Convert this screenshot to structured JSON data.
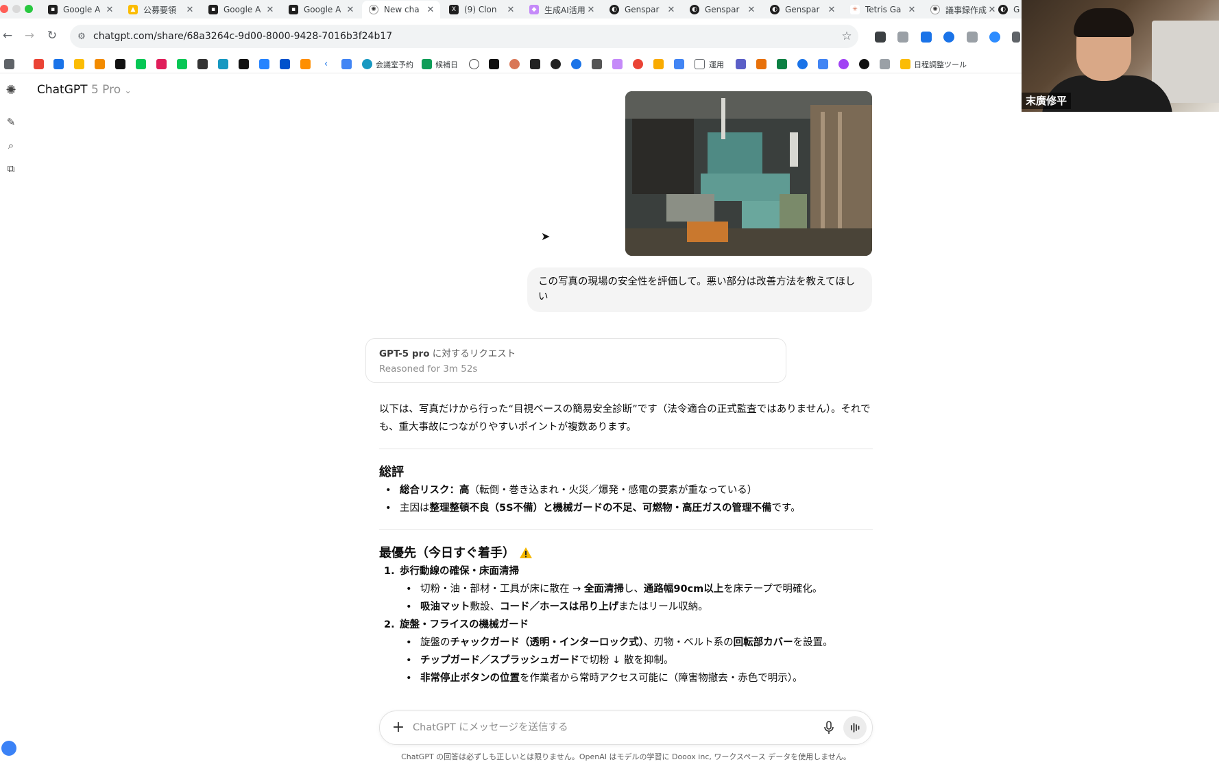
{
  "browser": {
    "tabs": [
      {
        "title": "Google A",
        "icon": "doc-icon"
      },
      {
        "title": "公募要領",
        "icon": "drive-icon"
      },
      {
        "title": "Google A",
        "icon": "doc-icon"
      },
      {
        "title": "Google A",
        "icon": "doc-icon"
      },
      {
        "title": "New cha",
        "icon": "openai-icon",
        "active": true
      },
      {
        "title": "(9) Clon",
        "icon": "x-icon"
      },
      {
        "title": "生成AI活用",
        "icon": "app-icon"
      },
      {
        "title": "Genspar",
        "icon": "genspark-icon"
      },
      {
        "title": "Genspar",
        "icon": "genspark-icon"
      },
      {
        "title": "Genspar",
        "icon": "genspark-icon"
      },
      {
        "title": "Tetris Ga",
        "icon": "claude-icon"
      },
      {
        "title": "議事録作成",
        "icon": "openai-icon"
      },
      {
        "title": "G",
        "icon": "genspark-icon"
      }
    ],
    "url": "chatgpt.com/share/68a3264c-9d00-8000-9428-7016b3f24b17",
    "bookmarks": {
      "meeting_room": "会議室予約",
      "candidate_day": "候補日",
      "operations": "運用",
      "scheduling_tool": "日程調整ツール"
    }
  },
  "webcam": {
    "participant_name": "末廣修平"
  },
  "chat": {
    "app_name": "ChatGPT",
    "model_variant": "5 Pro",
    "user_message": "この写真の現場の安全性を評価して。悪い部分は改善方法を教えてほしい",
    "reasoning": {
      "model": "GPT-5 pro",
      "request_suffix": " に対するリクエスト",
      "duration": "Reasoned for 3m 52s"
    },
    "answer": {
      "intro": "以下は、写真だけから行った“目視ベースの簡易安全診断”です（法令適合の正式監査ではありません）。それでも、重大事故につながりやすいポイントが複数あります。",
      "overall_heading": "総評",
      "overall_items": [
        {
          "bold": "総合リスク：高",
          "rest": "（転倒・巻き込まれ・火災／爆発・感電の要素が重なっている）"
        },
        {
          "pre": "主因は",
          "bold": "整理整頓不良（5S不備）と機械ガードの不足、可燃物・高圧ガスの管理不備",
          "rest": "です。"
        }
      ],
      "priority_heading": "最優先（今日すぐ着手）",
      "priority_items": [
        {
          "num": "1.",
          "title": "歩行動線の確保・床面清掃",
          "subs": [
            [
              "切粉・油・部材・工具が床に散在 → ",
              "全面清掃",
              "し、",
              "通路幅90cm以上",
              "を床テープで明確化。"
            ],
            [
              "",
              "吸油マット",
              "敷設、",
              "コード／ホースは吊り上げ",
              "またはリール収納。"
            ]
          ]
        },
        {
          "num": "2.",
          "title": "旋盤・フライスの機械ガード",
          "subs": [
            [
              "旋盤の",
              "チャックガード（透明・インターロック式）",
              "、刃物・ベルト系の",
              "回転部カバー",
              "を設置。"
            ],
            [
              "",
              "チップガード／スプラッシュガード",
              "で切粉 ↓ 散を抑制。",
              "",
              ""
            ],
            [
              "",
              "非常停止ボタンの位置",
              "を作業者から常時アクセス可能に（障害物撤去・赤色で明示）。",
              "",
              ""
            ]
          ]
        }
      ]
    },
    "composer": {
      "placeholder": "ChatGPT にメッセージを送信する"
    },
    "disclaimer": "ChatGPT の回答は必ずしも正しいとは限りません。OpenAI はモデルの学習に Dooox inc, ワークスペース データを使用しません。"
  },
  "colors": {
    "accent_blue": "#1a73e8",
    "bubble_bg": "#f4f4f4",
    "muted_text": "#8f8f8f",
    "warning": "#f5b800"
  }
}
